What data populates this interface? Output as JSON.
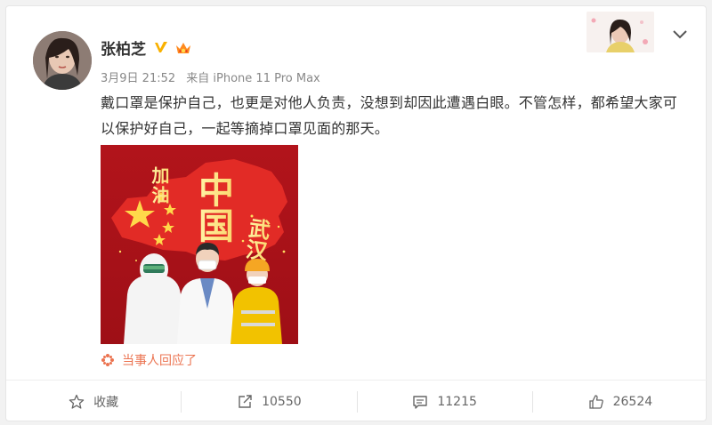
{
  "post": {
    "author": "张柏芝",
    "time": "3月9日 21:52",
    "source": "来自 iPhone 11 Pro Max",
    "text": "戴口罩是保护自己，也更是对他人负责，没想到却因此遭遇白眼。不管怎样，都希望大家可以保护好自己，一起等摘掉口罩见面的那天。",
    "image_text": {
      "top_left": "加油",
      "center": "中国",
      "right": "武汉"
    },
    "reply_link": "当事人回应了"
  },
  "actions": {
    "favorite_label": "收藏",
    "repost_count": "10550",
    "comment_count": "11215",
    "like_count": "26524"
  },
  "colors": {
    "accent": "#eb7350",
    "verified": "#f9b100",
    "poster_red": "#c8201f",
    "poster_gold": "#ffd84a"
  }
}
